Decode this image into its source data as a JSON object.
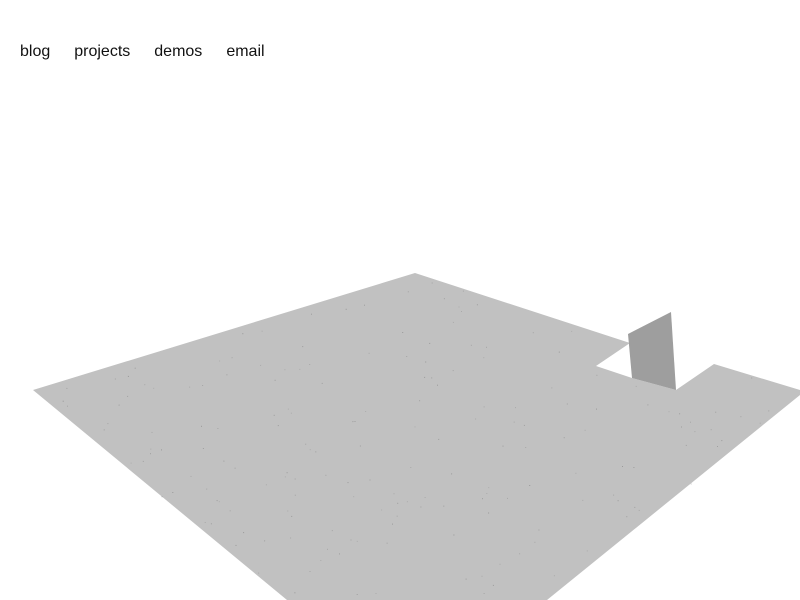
{
  "nav": {
    "items": [
      {
        "label": "blog"
      },
      {
        "label": "projects"
      },
      {
        "label": "demos"
      },
      {
        "label": "email"
      }
    ]
  },
  "scene": {
    "floor_color": "#c1c1c1",
    "wall_color": "#9e9e9e",
    "speckle_color": "#8a8a8a",
    "background_color": "#ffffff"
  }
}
